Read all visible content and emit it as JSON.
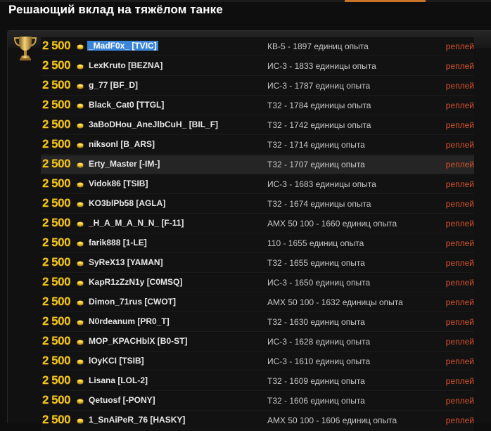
{
  "page": {
    "title": "Решающий вклад на тяжёлом танке"
  },
  "colors": {
    "score": "#f2c521",
    "replay_link": "#d8522d",
    "selection": "#3b86d9"
  },
  "icons": {
    "trophy": "trophy-icon",
    "coin": "coin-icon"
  },
  "rows": [
    {
      "score": "2 500",
      "player": "_MadF0x_ [TVIC]",
      "tank": "КВ-5 - 1897 единиц опыта",
      "replay": "реплей"
    },
    {
      "score": "2 500",
      "player": "LexKruto [BEZNA]",
      "tank": "ИС-3 - 1833 единицы опыта",
      "replay": "реплей"
    },
    {
      "score": "2 500",
      "player": "g_77 [BF_D]",
      "tank": "ИС-3 - 1787 единиц опыта",
      "replay": "реплей"
    },
    {
      "score": "2 500",
      "player": "Black_Cat0 [TTGL]",
      "tank": "Т32 - 1784 единицы опыта",
      "replay": "реплей"
    },
    {
      "score": "2 500",
      "player": "3aBoDHou_AneJlbCuH_ [BIL_F]",
      "tank": "Т32 - 1742 единицы опыта",
      "replay": "реплей"
    },
    {
      "score": "2 500",
      "player": "niksonl [B_ARS]",
      "tank": "Т32 - 1714 единиц опыта",
      "replay": "реплей"
    },
    {
      "score": "2 500",
      "player": "Erty_Master [-IM-]",
      "tank": "Т32 - 1707 единиц опыта",
      "replay": "реплей"
    },
    {
      "score": "2 500",
      "player": "Vidok86 [TSIB]",
      "tank": "ИС-3 - 1683 единицы опыта",
      "replay": "реплей"
    },
    {
      "score": "2 500",
      "player": "KO3blPb58 [AGLA]",
      "tank": "Т32 - 1674 единицы опыта",
      "replay": "реплей"
    },
    {
      "score": "2 500",
      "player": "_H_A_M_A_N_N_ [F-11]",
      "tank": "AMX 50 100 - 1660 единиц опыта",
      "replay": "реплей"
    },
    {
      "score": "2 500",
      "player": "farik888 [1-LE]",
      "tank": "110 - 1655 единиц опыта",
      "replay": "реплей"
    },
    {
      "score": "2 500",
      "player": "SyReX13 [YAMAN]",
      "tank": "Т32 - 1655 единиц опыта",
      "replay": "реплей"
    },
    {
      "score": "2 500",
      "player": "KapR1zZzN1y [C0MSQ]",
      "tank": "ИС-3 - 1650 единиц опыта",
      "replay": "реплей"
    },
    {
      "score": "2 500",
      "player": "Dimon_71rus [CWOT]",
      "tank": "AMX 50 100 - 1632 единицы опыта",
      "replay": "реплей"
    },
    {
      "score": "2 500",
      "player": "N0rdeanum [PR0_T]",
      "tank": "Т32 - 1630 единиц опыта",
      "replay": "реплей"
    },
    {
      "score": "2 500",
      "player": "MOP_KPACHblX [B0-ST]",
      "tank": "ИС-3 - 1628 единиц опыта",
      "replay": "реплей"
    },
    {
      "score": "2 500",
      "player": "lOyKCI [TSIB]",
      "tank": "ИС-3 - 1610 единиц опыта",
      "replay": "реплей"
    },
    {
      "score": "2 500",
      "player": "Lisana [LOL-2]",
      "tank": "Т32 - 1609 единиц опыта",
      "replay": "реплей"
    },
    {
      "score": "2 500",
      "player": "Qetuosf [-PONY]",
      "tank": "Т32 - 1606 единиц опыта",
      "replay": "реплей"
    },
    {
      "score": "2 500",
      "player": "1_SnAiPeR_76 [HASKY]",
      "tank": "AMX 50 100 - 1606 единиц опыта",
      "replay": "реплей"
    }
  ]
}
